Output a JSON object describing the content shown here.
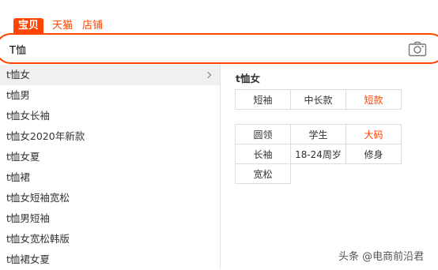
{
  "tabs": [
    {
      "label": "宝贝",
      "active": true
    },
    {
      "label": "天猫",
      "active": false
    },
    {
      "label": "店铺",
      "active": false
    }
  ],
  "search": {
    "value": "T恤",
    "camera_icon": "camera-icon"
  },
  "suggestions": [
    {
      "label": "t恤女"
    },
    {
      "label": "t恤男"
    },
    {
      "label": "t恤女长袖"
    },
    {
      "label": "t恤女2020年新款"
    },
    {
      "label": "t恤女夏"
    },
    {
      "label": "t恤裙"
    },
    {
      "label": "t恤女短袖宽松"
    },
    {
      "label": "t恤男短袖"
    },
    {
      "label": "t恤女宽松韩版"
    },
    {
      "label": "t恤裙女夏"
    }
  ],
  "panel": {
    "title": "t恤女",
    "group1": [
      [
        "短袖",
        "中长款",
        "短款"
      ]
    ],
    "group2": [
      [
        "圆领",
        "学生",
        "大码"
      ],
      [
        "长袖",
        "18-24周岁",
        "修身"
      ],
      [
        "宽松",
        "",
        ""
      ]
    ],
    "highlight": [
      "短款",
      "大码"
    ],
    "accent_color": "#ff4400"
  },
  "watermark": "头条 @电商前沿君"
}
